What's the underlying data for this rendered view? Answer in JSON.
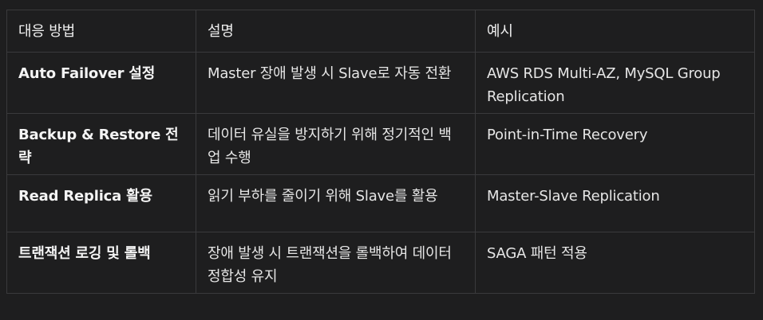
{
  "table": {
    "headers": [
      "대응 방법",
      "설명",
      "예시"
    ],
    "rows": [
      {
        "method": "Auto Failover 설정",
        "description": "Master 장애 발생 시 Slave로 자동 전환",
        "example": "AWS RDS Multi-AZ, MySQL Group Replication"
      },
      {
        "method": "Backup & Restore 전략",
        "description": "데이터 유실을 방지하기 위해 정기적인 백업 수행",
        "example": "Point-in-Time Recovery"
      },
      {
        "method": "Read Replica 활용",
        "description": "읽기 부하를 줄이기 위해 Slave를 활용",
        "example": "Master-Slave Replication"
      },
      {
        "method": "트랜잭션 로깅 및 롤백",
        "description": "장애 발생 시 트랜잭션을 롤백하여 데이터 정합성 유지",
        "example": "SAGA 패턴 적용"
      }
    ]
  }
}
